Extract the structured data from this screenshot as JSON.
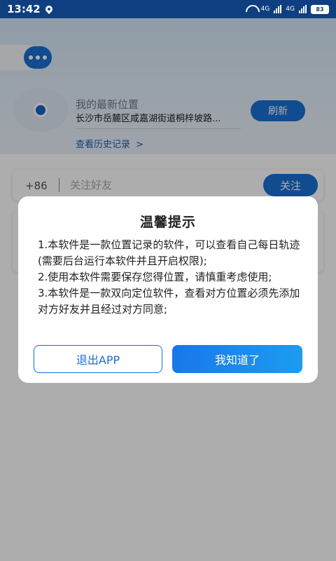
{
  "status_bar": {
    "time": "13:42",
    "network_1": "4G",
    "network_2": "4G",
    "battery": "83"
  },
  "location_card": {
    "title": "我的最新位置",
    "address": "长沙市岳麓区咸嘉湖街道桐梓坡路...",
    "refresh_label": "刷新",
    "history_label": "查看历史记录",
    "history_chevron": ">"
  },
  "follow_bar": {
    "country_code": "+86",
    "input_value": "",
    "input_placeholder": "关注好友",
    "follow_label": "关注"
  },
  "dialog": {
    "title": "温馨提示",
    "lines": [
      "1.本软件是一款位置记录的软件，可以查看自己每日轨迹(需要后台运行本软件并且开启权限);",
      "2.使用本软件需要保存您得位置，请慎重考虑使用;",
      "3.本软件是一款双向定位软件，查看对方位置必须先添加对方好友并且经过对方同意;"
    ],
    "exit_label": "退出APP",
    "ok_label": "我知道了"
  },
  "colors": {
    "accent": "#1a6fd4",
    "status_bar": "#0f3f80",
    "overlay": "rgba(0,0,0,0.32)"
  },
  "icons": [
    "location-pin-icon",
    "wifi-icon",
    "signal-icon",
    "battery-icon",
    "more-icon",
    "chevron-right-icon"
  ]
}
